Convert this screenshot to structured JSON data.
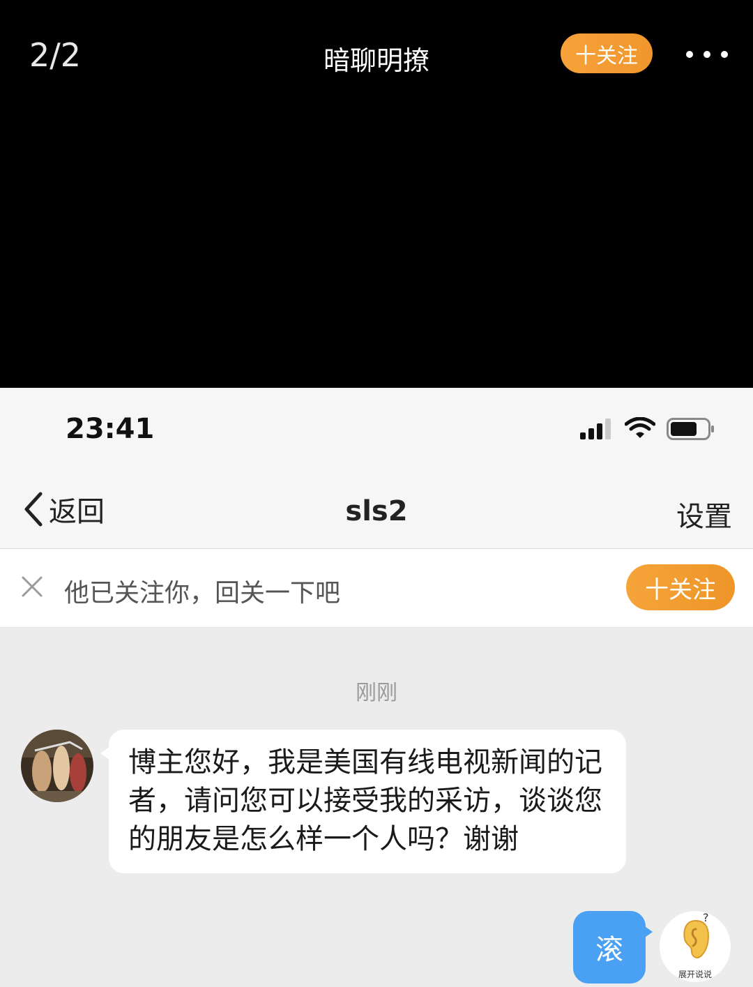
{
  "viewer": {
    "counter": "2/2",
    "title": "暗聊明撩",
    "follow_label": "十关注",
    "more_icon": "more-dots-icon"
  },
  "status_bar": {
    "time": "23:41",
    "icons": [
      "signal-icon",
      "wifi-icon",
      "battery-icon"
    ]
  },
  "nav": {
    "back_label": "返回",
    "title": "sls2",
    "settings_label": "设置"
  },
  "follow_banner": {
    "text": "他已关注你，回关一下吧",
    "button_label": "十关注",
    "close_icon": "close-icon"
  },
  "chat": {
    "timestamp": "刚刚",
    "messages": [
      {
        "side": "left",
        "text": "博主您好，我是美国有线电视新闻的记者，请问您可以接受我的采访，谈谈您的朋友是怎么样一个人吗？谢谢"
      },
      {
        "side": "right",
        "text": "滚"
      }
    ],
    "ear_label": "展开说说",
    "ear_mark": "?"
  },
  "colors": {
    "accent_orange": "#f29a30",
    "reply_blue": "#4aa0f2",
    "chat_bg": "#ececec"
  }
}
